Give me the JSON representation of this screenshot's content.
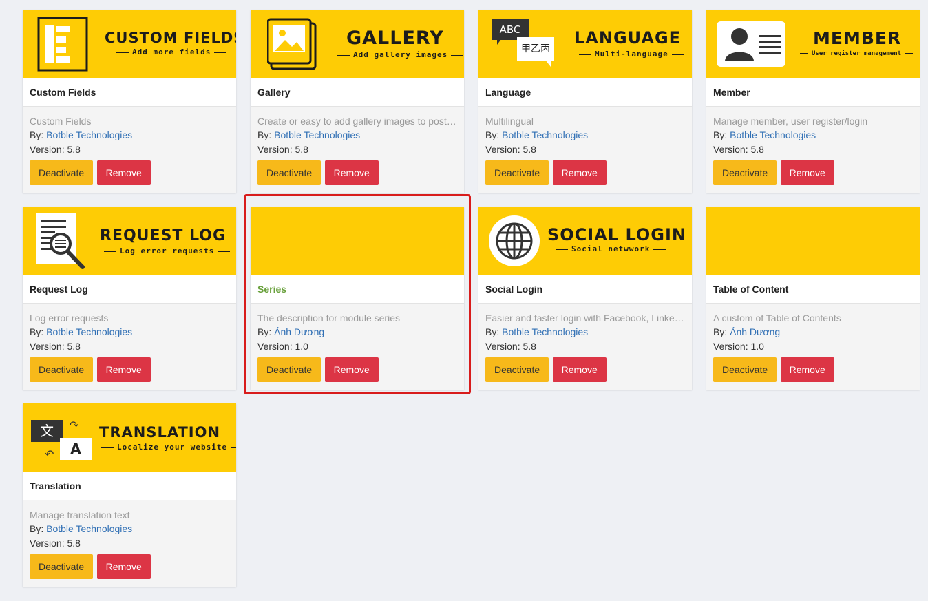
{
  "colors": {
    "banner": "#fecc05",
    "deactivate": "#f7b91a",
    "remove": "#dc3545",
    "author_link": "#3170b5",
    "highlight": "#d81c1c",
    "active_title": "#68a03b"
  },
  "labels": {
    "by": "By: ",
    "version": "Version: "
  },
  "plugins": [
    {
      "name": "Custom Fields",
      "banner_title": "CUSTOM FIELDS",
      "banner_subtitle": "Add more fields",
      "icon": "list-layout-icon",
      "description": "Custom Fields",
      "author": "Botble Technologies",
      "version": "5.8",
      "deactivate_label": "Deactivate",
      "remove_label": "Remove"
    },
    {
      "name": "Gallery",
      "banner_title": "GALLERY",
      "banner_subtitle": "Add gallery images",
      "icon": "gallery-images-icon",
      "description": "Create or easy to add gallery images to posts...",
      "author": "Botble Technologies",
      "version": "5.8",
      "deactivate_label": "Deactivate",
      "remove_label": "Remove"
    },
    {
      "name": "Language",
      "banner_title": "LANGUAGE",
      "banner_subtitle": "Multi-language",
      "icon": "language-bubbles-icon",
      "icon_text_1": "ABC",
      "icon_text_2": "甲乙丙",
      "description": "Multilingual",
      "author": "Botble Technologies",
      "version": "5.8",
      "deactivate_label": "Deactivate",
      "remove_label": "Remove"
    },
    {
      "name": "Member",
      "banner_title": "MEMBER",
      "banner_subtitle": "User register management",
      "icon": "member-card-icon",
      "description": "Manage member, user register/login",
      "author": "Botble Technologies",
      "version": "5.8",
      "deactivate_label": "Deactivate",
      "remove_label": "Remove"
    },
    {
      "name": "Request Log",
      "banner_title": "REQUEST LOG",
      "banner_subtitle": "Log error requests",
      "icon": "document-search-icon",
      "description": "Log error requests",
      "author": "Botble Technologies",
      "version": "5.8",
      "deactivate_label": "Deactivate",
      "remove_label": "Remove"
    },
    {
      "name": "Series",
      "banner_title": "",
      "banner_subtitle": "",
      "icon": "",
      "description": "The description for module series",
      "author": "Ánh Dương",
      "version": "1.0",
      "deactivate_label": "Deactivate",
      "remove_label": "Remove",
      "highlighted": true
    },
    {
      "name": "Social Login",
      "banner_title": "SOCIAL LOGIN",
      "banner_subtitle": "Social netwwork",
      "icon": "globe-icon",
      "description": "Easier and faster login with Facebook, Linked...",
      "author": "Botble Technologies",
      "version": "5.8",
      "deactivate_label": "Deactivate",
      "remove_label": "Remove"
    },
    {
      "name": "Table of Content",
      "banner_title": "",
      "banner_subtitle": "",
      "icon": "",
      "description": "A custom of Table of Contents",
      "author": "Ánh Dương",
      "version": "1.0",
      "deactivate_label": "Deactivate",
      "remove_label": "Remove"
    },
    {
      "name": "Translation",
      "banner_title": "TRANSLATION",
      "banner_subtitle": "Localize your website",
      "icon": "translate-icon",
      "icon_text_1": "文",
      "icon_text_2": "A",
      "description": "Manage translation text",
      "author": "Botble Technologies",
      "version": "5.8",
      "deactivate_label": "Deactivate",
      "remove_label": "Remove"
    }
  ]
}
